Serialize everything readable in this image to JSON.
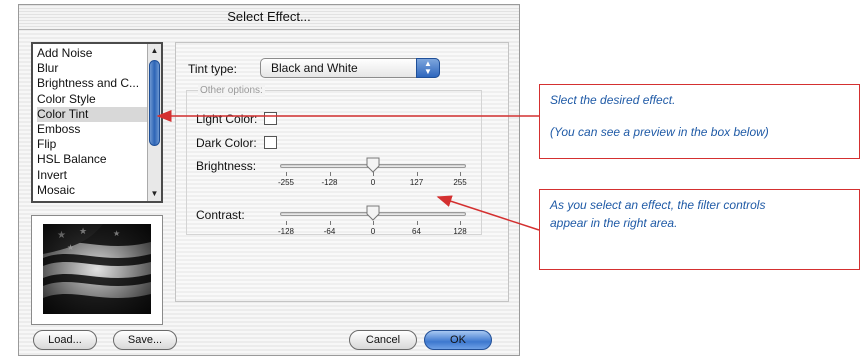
{
  "dialog": {
    "title": "Select Effect...",
    "effects": [
      "Add Noise",
      "Blur",
      "Brightness and C...",
      "Color Style",
      "Color Tint",
      "Emboss",
      "Flip",
      "HSL Balance",
      "Invert",
      "Mosaic"
    ],
    "selected_effect": "Color Tint",
    "tint_type_label": "Tint type:",
    "tint_type_value": "Black and White",
    "other_options_label": "Other options:",
    "light_color_label": "Light Color:",
    "dark_color_label": "Dark Color:",
    "brightness_label": "Brightness:",
    "brightness_ticks": [
      "-255",
      "-128",
      "0",
      "127",
      "255"
    ],
    "brightness_value": 0,
    "contrast_label": "Contrast:",
    "contrast_ticks": [
      "-128",
      "-64",
      "0",
      "64",
      "128"
    ],
    "contrast_value": 0,
    "buttons": {
      "load": "Load...",
      "save": "Save...",
      "cancel": "Cancel",
      "ok": "OK"
    }
  },
  "callouts": {
    "select": [
      "Slect the desired effect.",
      "(You can see a preview in the box below)"
    ],
    "controls": [
      "As you select an effect, the filter controls",
      "appear in the right area."
    ]
  },
  "colors": {
    "callout_border": "#d43030",
    "callout_text": "#1f5aa6",
    "accent_blue": "#2e66bd"
  },
  "icons": {
    "scroll_up": "▲",
    "scroll_down": "▼",
    "popup_up": "▲",
    "popup_down": "▼"
  }
}
